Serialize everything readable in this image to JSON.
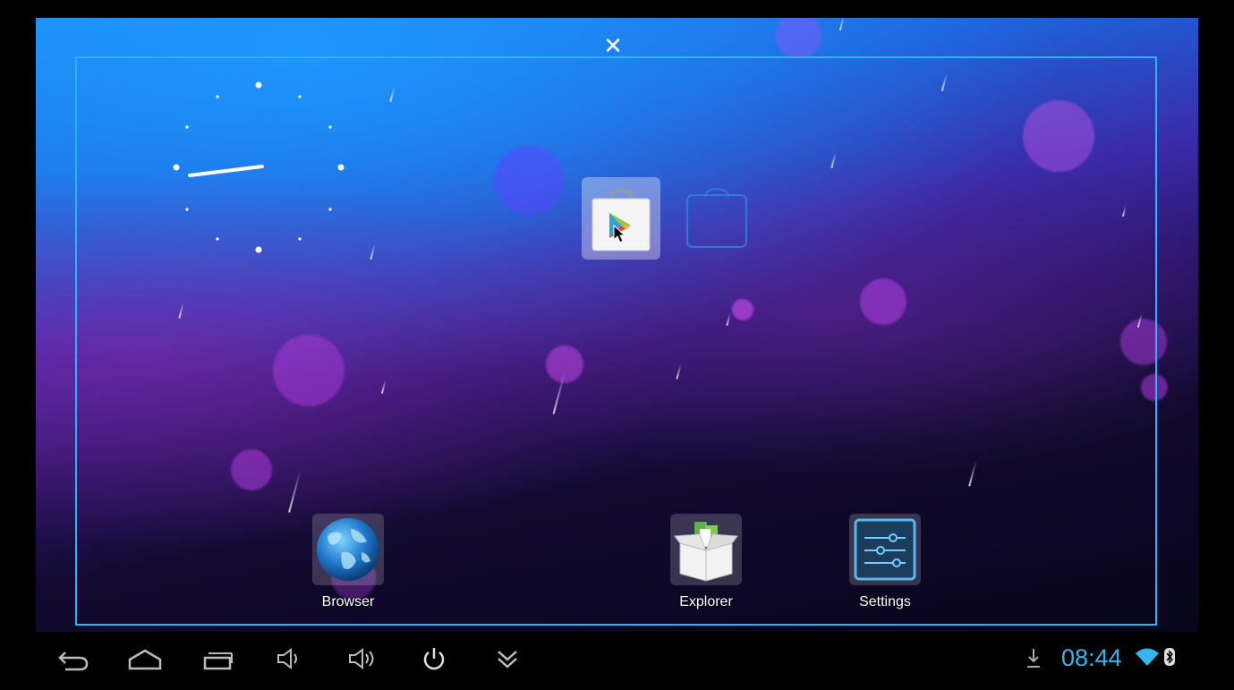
{
  "window": {
    "close_glyph": "✕"
  },
  "home": {
    "clock_widget": {
      "type": "analog",
      "hour_hand": "9",
      "minute_hand": "44"
    },
    "featured_app": {
      "icon": "play-store-icon"
    },
    "drop_target_icon": "shopping-bag-outline-icon",
    "apps": [
      {
        "label": "Browser",
        "icon": "globe-icon"
      },
      {
        "label": "Explorer",
        "icon": "explorer-box-icon"
      },
      {
        "label": "Settings",
        "icon": "sliders-icon"
      }
    ]
  },
  "navbar": {
    "buttons": [
      {
        "icon": "back-icon"
      },
      {
        "icon": "home-icon"
      },
      {
        "icon": "recent-apps-icon"
      },
      {
        "icon": "volume-down-icon"
      },
      {
        "icon": "volume-up-icon"
      },
      {
        "icon": "power-icon"
      },
      {
        "icon": "expand-down-icon"
      }
    ],
    "status": {
      "time": "08:44",
      "icons": [
        "download-icon",
        "wifi-icon",
        "bluetooth-icon"
      ]
    }
  },
  "colors": {
    "accent": "#35b5f0",
    "frame": "#2db2ff"
  }
}
